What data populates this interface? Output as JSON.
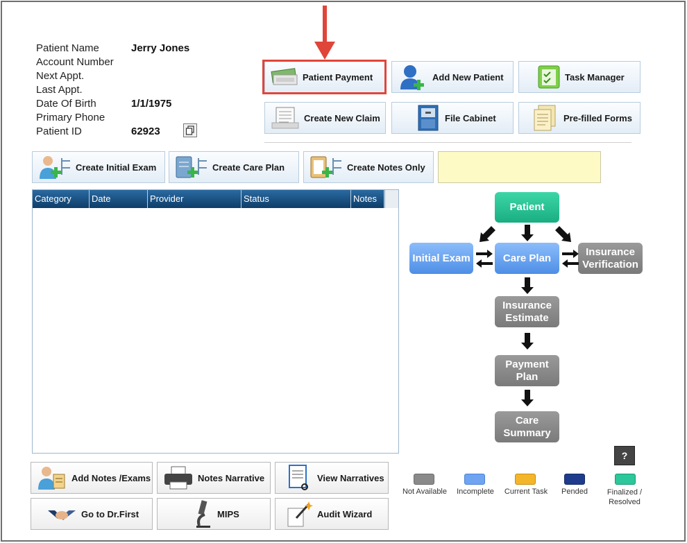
{
  "patient": {
    "labels": {
      "name": "Patient Name",
      "account": "Account Number",
      "next_appt": "Next Appt.",
      "last_appt": "Last Appt.",
      "dob": "Date Of Birth",
      "phone": "Primary Phone",
      "id": "Patient ID"
    },
    "values": {
      "name": "Jerry  Jones",
      "account": "",
      "next_appt": "",
      "last_appt": "",
      "dob": "1/1/1975",
      "phone": "",
      "id": "62923"
    }
  },
  "toolbar": {
    "patient_payment": "Patient Payment",
    "add_new_patient": "Add New Patient",
    "task_manager": "Task Manager",
    "create_new_claim": "Create New Claim",
    "file_cabinet": "File Cabinet",
    "prefilled_forms": "Pre-filled Forms"
  },
  "actions": {
    "create_initial_exam": "Create Initial Exam",
    "create_care_plan": "Create Care Plan",
    "create_notes_only": "Create Notes Only"
  },
  "grid": {
    "columns": [
      "Category",
      "Date",
      "Provider",
      "Status",
      "Notes"
    ]
  },
  "bottom_buttons": {
    "add_notes_exams": "Add Notes /Exams",
    "notes_narrative": "Notes Narrative",
    "view_narratives": "View Narratives",
    "go_to_drfirst": "Go to Dr.First",
    "mips": "MIPS",
    "audit_wizard": "Audit Wizard"
  },
  "workflow": {
    "patient": "Patient",
    "initial_exam": "Initial Exam",
    "care_plan": "Care Plan",
    "insurance_verification_1": "Insurance",
    "insurance_verification_2": "Verification",
    "insurance_estimate_1": "Insurance",
    "insurance_estimate_2": "Estimate",
    "payment_plan_1": "Payment",
    "payment_plan_2": "Plan",
    "care_summary_1": "Care",
    "care_summary_2": "Summary"
  },
  "legend": {
    "not_available": "Not Available",
    "incomplete": "Incomplete",
    "current_task": "Current Task",
    "pended": "Pended",
    "finalized_1": "Finalized /",
    "finalized_2": "Resolved",
    "help": "?"
  },
  "colors": {
    "not_available": "#8a8a8a",
    "incomplete": "#6ea4f2",
    "current_task": "#f3b52a",
    "pended": "#1f3c8c",
    "finalized": "#2cc79a",
    "highlight": "#e0453a"
  }
}
